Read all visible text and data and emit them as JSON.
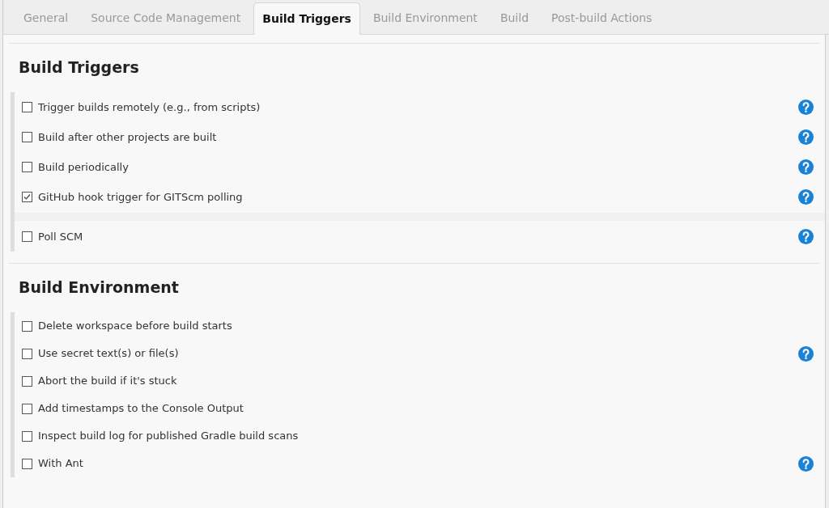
{
  "tabs": [
    {
      "label": "General",
      "selected": false
    },
    {
      "label": "Source Code Management",
      "selected": false
    },
    {
      "label": "Build Triggers",
      "selected": true
    },
    {
      "label": "Build Environment",
      "selected": false
    },
    {
      "label": "Build",
      "selected": false
    },
    {
      "label": "Post-build Actions",
      "selected": false
    }
  ],
  "sections": [
    {
      "title": "Build Triggers",
      "options": [
        {
          "label": "Trigger builds remotely (e.g., from scripts)",
          "checked": false,
          "help": true,
          "expanded": false
        },
        {
          "label": "Build after other projects are built",
          "checked": false,
          "help": true,
          "expanded": false
        },
        {
          "label": "Build periodically",
          "checked": false,
          "help": true,
          "expanded": false
        },
        {
          "label": "GitHub hook trigger for GITScm polling",
          "checked": true,
          "help": true,
          "expanded": true
        },
        {
          "label": "Poll SCM",
          "checked": false,
          "help": true,
          "expanded": false
        }
      ]
    },
    {
      "title": "Build Environment",
      "options": [
        {
          "label": "Delete workspace before build starts",
          "checked": false,
          "help": false
        },
        {
          "label": "Use secret text(s) or file(s)",
          "checked": false,
          "help": true
        },
        {
          "label": "Abort the build if it's stuck",
          "checked": false,
          "help": false
        },
        {
          "label": "Add timestamps to the Console Output",
          "checked": false,
          "help": false
        },
        {
          "label": "Inspect build log for published Gradle build scans",
          "checked": false,
          "help": false
        },
        {
          "label": "With Ant",
          "checked": false,
          "help": true
        }
      ]
    }
  ]
}
